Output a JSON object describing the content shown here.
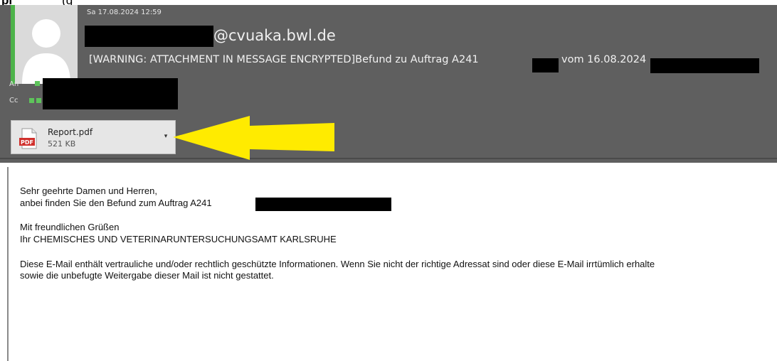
{
  "caption": {
    "bold_text": "pl",
    "normal_text": "(g"
  },
  "email": {
    "timestamp": "Sa 17.08.2024 12:59",
    "sender_domain": "@cvuaka.bwl.de",
    "subject_prefix": "[WARNING: ATTACHMENT IN MESSAGE ENCRYPTED]Befund zu Auftrag A241",
    "subject_suffix": "vom 16.08.2024",
    "to_label": "An",
    "cc_label": "Cc"
  },
  "attachment": {
    "icon_label": "PDF",
    "name": "Report.pdf",
    "size": "521 KB",
    "dropdown_icon": "chevron-down-icon"
  },
  "body": {
    "greeting": "Sehr geehrte Damen und Herren,",
    "line2_prefix": "anbei finden Sie den Befund zum Auftrag  A241",
    "closing": "Mit freundlichen Grüßen",
    "signature": "Ihr CHEMISCHES UND VETERINARUNTERSUCHUNGSAMT KARLSRUHE",
    "disclaimer_line1": "Diese E-Mail enthält vertrauliche und/oder rechtlich geschützte Informationen. Wenn Sie nicht der richtige Adressat sind oder diese E-Mail irrtümlich erhalte",
    "disclaimer_line2": "sowie die unbefugte Weitergabe dieser Mail ist nicht gestattet."
  },
  "colors": {
    "header_bg": "#5f5f5f",
    "accent_green": "#4db34a",
    "annotation_arrow": "#ffeb00",
    "redaction": "#000000"
  }
}
